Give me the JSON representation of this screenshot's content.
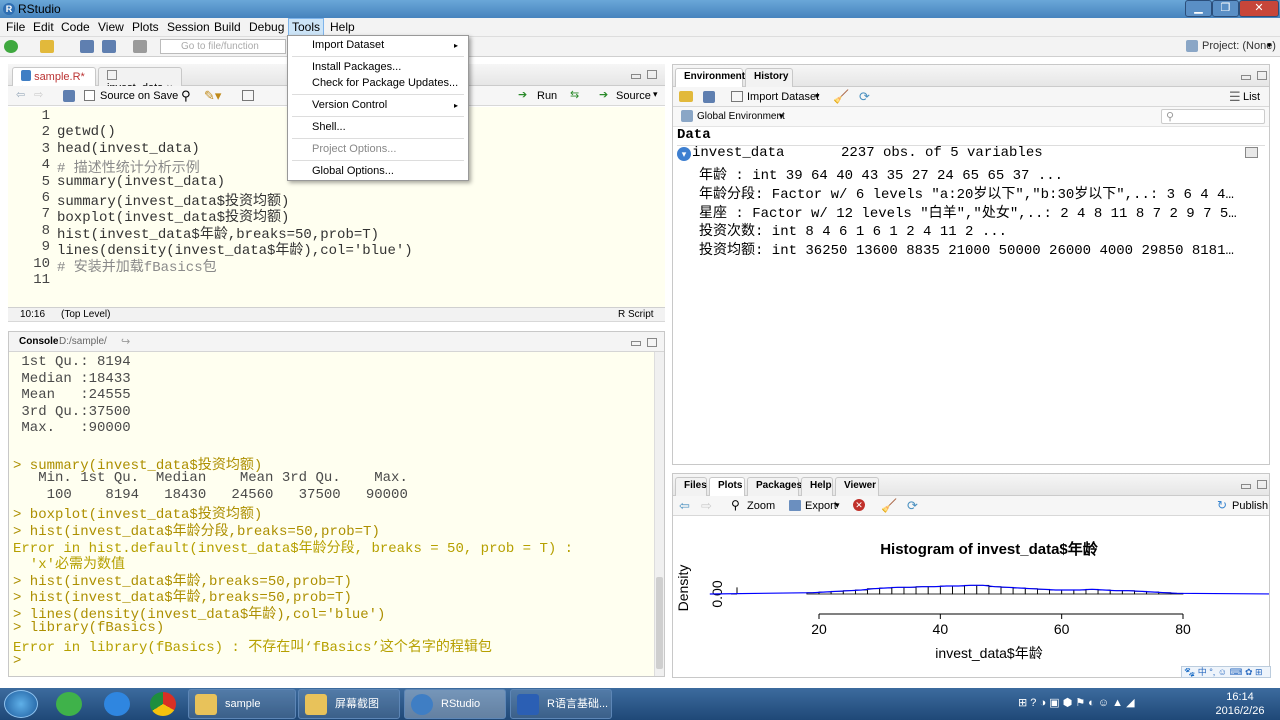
{
  "window": {
    "title": "RStudio"
  },
  "menubar": [
    "File",
    "Edit",
    "Code",
    "View",
    "Plots",
    "Session",
    "Build",
    "Debug",
    "Tools",
    "Help"
  ],
  "toolbar": {
    "goto_placeholder": "Go to file/function",
    "project": "Project: (None)"
  },
  "tools_menu": {
    "items": [
      {
        "label": "Import Dataset",
        "submenu": true,
        "disabled": false
      },
      {
        "label": "Install Packages...",
        "submenu": false,
        "disabled": false
      },
      {
        "label": "Check for Package Updates...",
        "submenu": false,
        "disabled": false
      },
      {
        "label": "Version Control",
        "submenu": true,
        "disabled": false
      },
      {
        "label": "Shell...",
        "submenu": false,
        "disabled": false
      },
      {
        "label": "Project Options...",
        "submenu": false,
        "disabled": true
      },
      {
        "label": "Global Options...",
        "submenu": false,
        "disabled": false
      }
    ]
  },
  "editor": {
    "tabs": [
      {
        "label": "sample.R*",
        "active": true
      },
      {
        "label": "invest_data",
        "active": false
      }
    ],
    "source_on_save": "Source on Save",
    "run_label": "Run",
    "source_label": "Source",
    "lines": [
      "",
      "getwd()",
      "head(invest_data)",
      "# 描述性统计分析示例",
      "summary(invest_data)",
      "summary(invest_data$投资均额)",
      "boxplot(invest_data$投资均额)",
      "hist(invest_data$年龄,breaks=50,prob=T)",
      "lines(density(invest_data$年龄),col='blue')",
      "# 安装并加载fBasics包",
      ""
    ],
    "status": {
      "position": "10:16",
      "scope": "(Top Level)",
      "filetype": "R Script"
    }
  },
  "console": {
    "title": "Console",
    "path": "D:/sample/",
    "lines": [
      {
        "t": " 1st Qu.: 8194",
        "k": "out"
      },
      {
        "t": " Median :18433",
        "k": "out"
      },
      {
        "t": " Mean   :24555",
        "k": "out"
      },
      {
        "t": " 3rd Qu.:37500",
        "k": "out"
      },
      {
        "t": " Max.   :90000",
        "k": "out"
      },
      {
        "t": "",
        "k": "out"
      },
      {
        "t": "> summary(invest_data$投资均额)",
        "k": "cmd"
      },
      {
        "t": "   Min. 1st Qu.  Median    Mean 3rd Qu.    Max.",
        "k": "out"
      },
      {
        "t": "    100    8194   18430   24560   37500   90000",
        "k": "out"
      },
      {
        "t": "> boxplot(invest_data$投资均额)",
        "k": "cmd"
      },
      {
        "t": "> hist(invest_data$年龄分段,breaks=50,prob=T)",
        "k": "cmd"
      },
      {
        "t": "Error in hist.default(invest_data$年龄分段, breaks = 50, prob = T) :",
        "k": "err"
      },
      {
        "t": "  'x'必需为数值",
        "k": "err"
      },
      {
        "t": "> hist(invest_data$年龄,breaks=50,prob=T)",
        "k": "cmd"
      },
      {
        "t": "> hist(invest_data$年龄,breaks=50,prob=T)",
        "k": "cmd"
      },
      {
        "t": "> lines(density(invest_data$年龄),col='blue')",
        "k": "cmd"
      },
      {
        "t": "> library(fBasics)",
        "k": "cmd"
      },
      {
        "t": "Error in library(fBasics) : 不存在叫‘fBasics’这个名字的程辑包",
        "k": "err"
      },
      {
        "t": "> ",
        "k": "cmd"
      }
    ]
  },
  "environment": {
    "tabs": [
      {
        "label": "Environment",
        "active": true
      },
      {
        "label": "History",
        "active": false
      }
    ],
    "import_dataset": "Import Dataset",
    "list_label": "List",
    "scope": "Global Environment",
    "section": "Data",
    "object": {
      "name": "invest_data",
      "summary": "2237 obs. of 5 variables"
    },
    "fields": [
      "年龄 : int 39 64 40 43 35 27 24 65 65 37 ...",
      "年龄分段: Factor w/ 6 levels \"a:20岁以下\",\"b:30岁以下\",..: 3 6 4 4…",
      "星座 : Factor w/ 12 levels \"白羊\",\"处女\",..: 2 4 8 11 8 7 2 9 7 5…",
      "投资次数: int 8 4 6 1 6 1 2 4 11 2 ...",
      "投资均额: int 36250 13600 8835 21000 50000 26000 4000 29850 8181…"
    ]
  },
  "plots_pane": {
    "tabs": [
      {
        "label": "Files",
        "active": false
      },
      {
        "label": "Plots",
        "active": true
      },
      {
        "label": "Packages",
        "active": false
      },
      {
        "label": "Help",
        "active": false
      },
      {
        "label": "Viewer",
        "active": false
      }
    ],
    "zoom": "Zoom",
    "export": "Export",
    "publish": "Publish"
  },
  "chart_data": {
    "type": "bar",
    "title": "Histogram of invest_data$年龄",
    "xlabel": "invest_data$年龄",
    "ylabel": "Density",
    "x_ticks": [
      20,
      40,
      60,
      80
    ],
    "y_ticks": [
      "0.00"
    ],
    "xlim": [
      20,
      80
    ],
    "ylim": [
      0,
      0.12
    ],
    "bin_width": 2,
    "bins_x": [
      18,
      20,
      22,
      24,
      26,
      28,
      30,
      32,
      34,
      36,
      38,
      40,
      42,
      44,
      46,
      48,
      50,
      52,
      54,
      56,
      58,
      60,
      62,
      64,
      66,
      68,
      70,
      72,
      74,
      76,
      78
    ],
    "densities": [
      0.004,
      0.006,
      0.008,
      0.01,
      0.012,
      0.016,
      0.018,
      0.02,
      0.02,
      0.022,
      0.022,
      0.024,
      0.024,
      0.026,
      0.026,
      0.022,
      0.02,
      0.018,
      0.016,
      0.014,
      0.012,
      0.012,
      0.012,
      0.014,
      0.012,
      0.01,
      0.01,
      0.008,
      0.006,
      0.004,
      0.002
    ],
    "density_line_color": "#0000ff"
  },
  "taskbar": {
    "items": [
      "sample",
      "屏幕截图",
      "RStudio",
      "R语言基础..."
    ],
    "time": "16:14",
    "date": "2016/2/26"
  }
}
